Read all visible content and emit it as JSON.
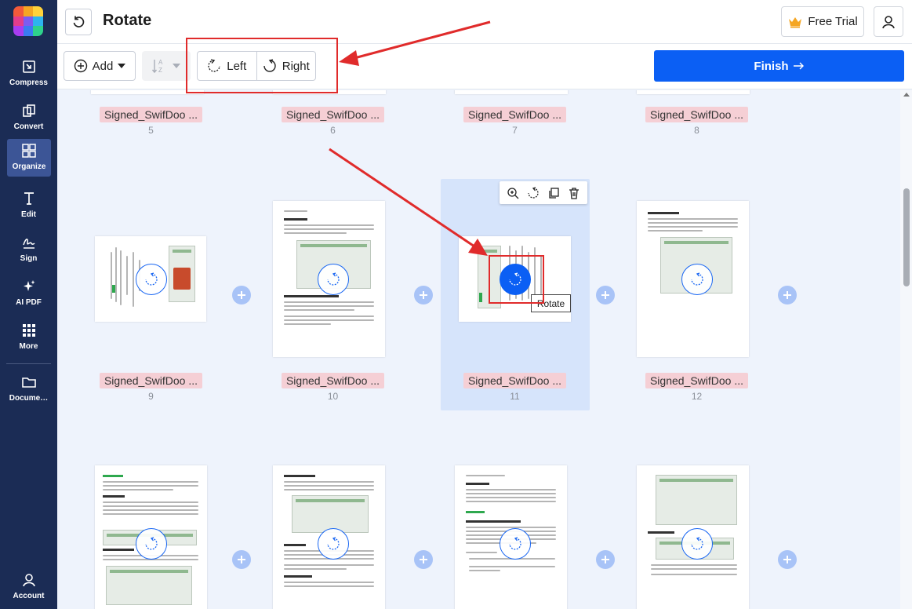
{
  "header": {
    "title": "Rotate",
    "trial_label": "Free Trial"
  },
  "sidebar": {
    "items": [
      {
        "label": "Compress",
        "icon": "compress-icon"
      },
      {
        "label": "Convert",
        "icon": "convert-icon"
      },
      {
        "label": "Organize",
        "icon": "organize-icon",
        "active": true
      },
      {
        "label": "Edit",
        "icon": "edit-icon"
      },
      {
        "label": "Sign",
        "icon": "sign-icon"
      },
      {
        "label": "AI PDF",
        "icon": "ai-sparkle-icon"
      },
      {
        "label": "More",
        "icon": "grid-icon"
      },
      {
        "label": "Docume…",
        "icon": "folder-icon"
      }
    ],
    "account_label": "Account"
  },
  "toolbar": {
    "add_label": "Add",
    "left_label": "Left",
    "right_label": "Right",
    "finish_label": "Finish"
  },
  "pages": {
    "row1": [
      {
        "name": "Signed_SwifDoo ...",
        "number": "5"
      },
      {
        "name": "Signed_SwifDoo ...",
        "number": "6"
      },
      {
        "name": "Signed_SwifDoo ...",
        "number": "7"
      },
      {
        "name": "Signed_SwifDoo ...",
        "number": "8"
      }
    ],
    "row2": [
      {
        "name": "Signed_SwifDoo ...",
        "number": "9"
      },
      {
        "name": "Signed_SwifDoo ...",
        "number": "10"
      },
      {
        "name": "Signed_SwifDoo ...",
        "number": "11"
      },
      {
        "name": "Signed_SwifDoo ...",
        "number": "12"
      }
    ]
  },
  "tooltip": "Rotate",
  "colors": {
    "sidebar": "#1b2c55",
    "accent": "#0b5ff4",
    "filename_bg": "#f5cfd5",
    "annotation": "#e02b2b"
  }
}
